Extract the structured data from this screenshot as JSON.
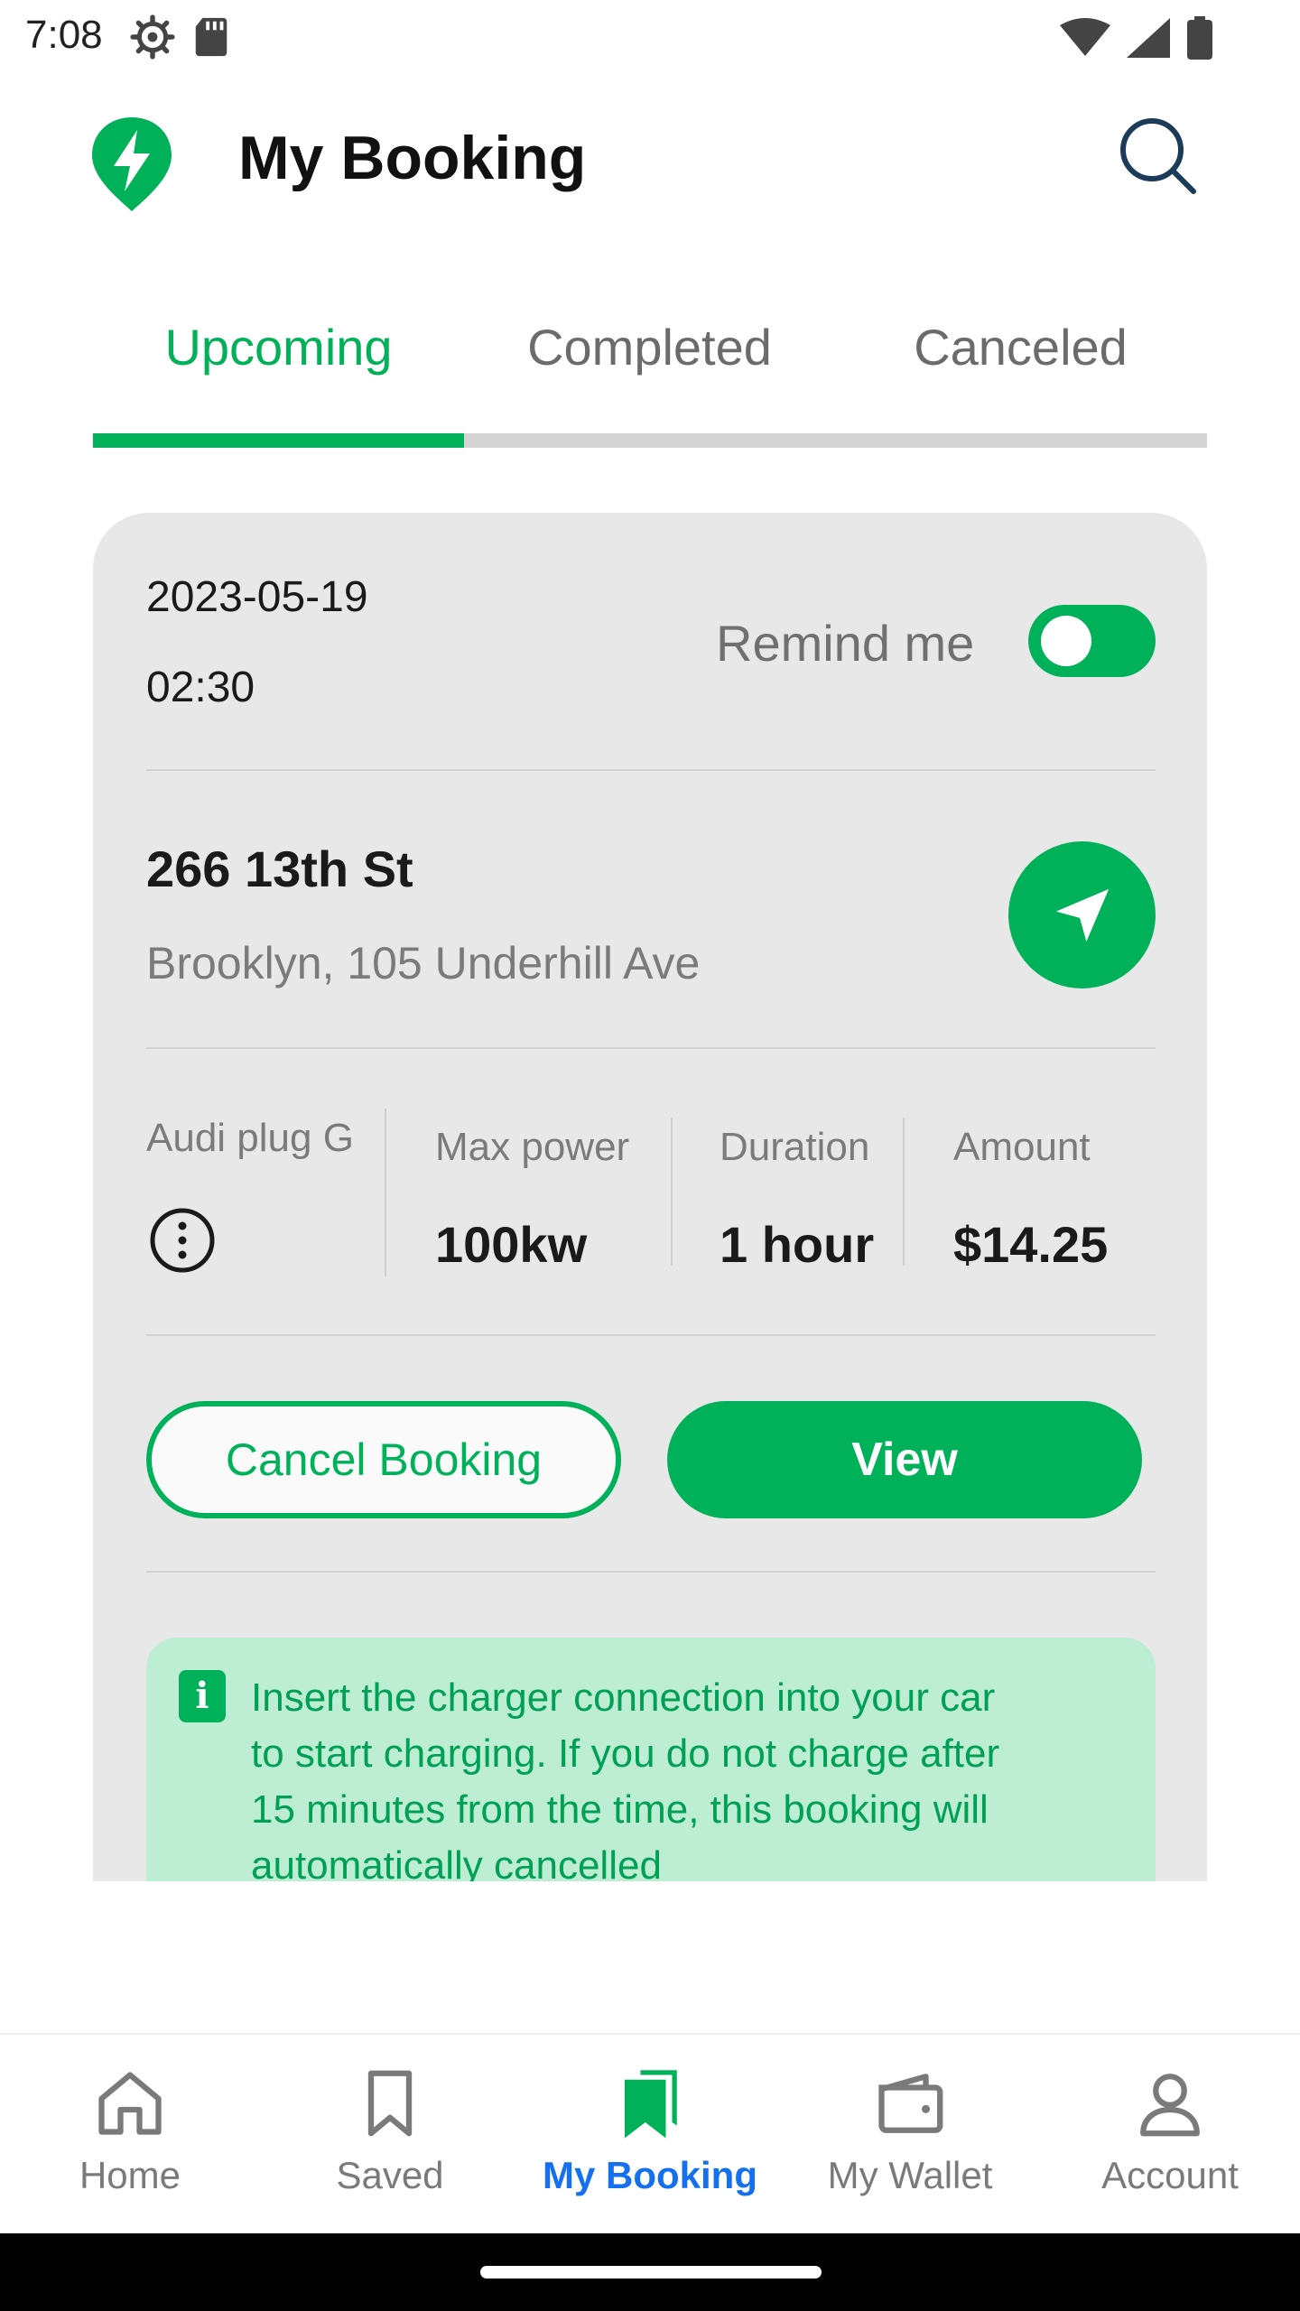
{
  "status_bar": {
    "time": "7:08",
    "icons": [
      "gear-icon",
      "sd-card-icon",
      "wifi-icon",
      "signal-icon",
      "battery-icon"
    ]
  },
  "header": {
    "title": "My Booking",
    "logo_icon": "bolt-pin-icon",
    "search_icon": "search-icon"
  },
  "tabs": [
    {
      "label": "Upcoming",
      "active": true
    },
    {
      "label": "Completed",
      "active": false
    },
    {
      "label": "Canceled",
      "active": false
    }
  ],
  "booking": {
    "date": "2023-05-19",
    "time": "02:30",
    "remind_label": "Remind me",
    "remind_on": true,
    "street": "266 13th St",
    "city": "Brooklyn, 105 Underhill Ave",
    "specs": [
      {
        "label": "Audi plug G",
        "value": ""
      },
      {
        "label": "Max power",
        "value": "100kw"
      },
      {
        "label": "Duration",
        "value": "1 hour"
      },
      {
        "label": "Amount",
        "value": "$14.25"
      }
    ],
    "cancel_label": "Cancel Booking",
    "view_label": "View",
    "notice_icon": "i",
    "notice": "Insert the charger connection into your car to start charging. If you do not charge after 15 minutes from the time, this booking will automatically cancelled"
  },
  "bottom_nav": [
    {
      "label": "Home",
      "icon": "home-icon",
      "active": false
    },
    {
      "label": "Saved",
      "icon": "bookmark-icon",
      "active": false
    },
    {
      "label": "My Booking",
      "icon": "bookings-icon",
      "active": true
    },
    {
      "label": "My Wallet",
      "icon": "wallet-icon",
      "active": false
    },
    {
      "label": "Account",
      "icon": "account-icon",
      "active": false
    }
  ],
  "colors": {
    "accent": "#00b15a",
    "active_nav": "#1570ef",
    "card_bg": "#e8e8e8",
    "notice_bg": "#bdeed4"
  }
}
